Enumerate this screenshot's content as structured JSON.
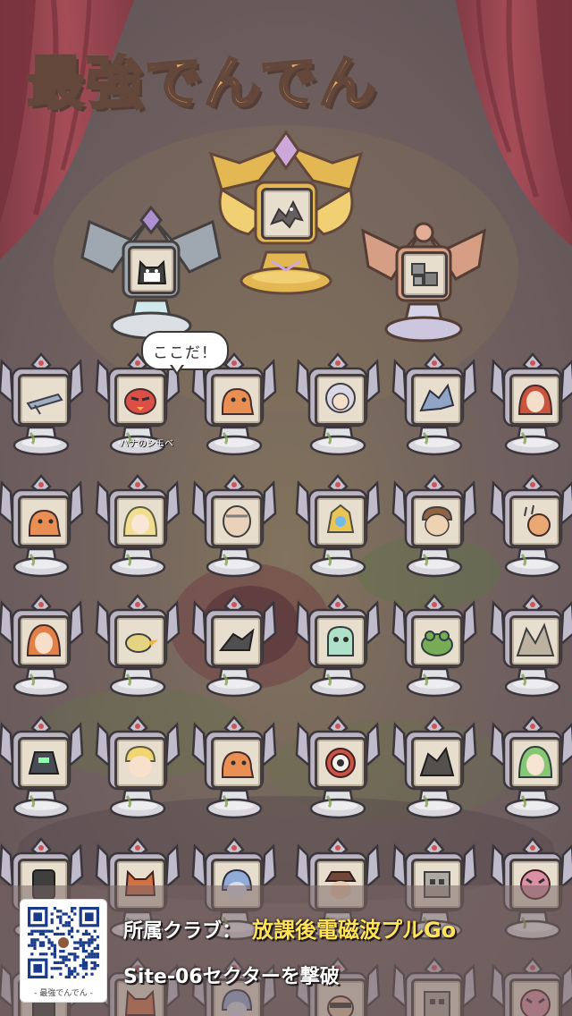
{
  "game": {
    "logo_text": "最強でんでん"
  },
  "bubble": {
    "text": "ここだ！"
  },
  "selected_character": {
    "label": "ハナのシモベ"
  },
  "banner": {
    "club_label": "所属クラブ：",
    "club_name": "放課後電磁波プルGo",
    "sector_text": "Site-06セクターを撃破",
    "qr_caption": "- 最強でんでん -"
  },
  "colors": {
    "curtain": "#9b3b47",
    "club_name": "#ffe15a",
    "gold_trophy": "#e2b348",
    "silver_trophy": "#9aa3ad",
    "bronze_trophy": "#d49a7e",
    "pedestal": "#c9c3cf"
  },
  "top_trophies": [
    {
      "rank": "gold",
      "icon": "dragon-portrait-icon"
    },
    {
      "rank": "silver",
      "icon": "cat-portrait-icon"
    },
    {
      "rank": "bronze",
      "icon": "robot-portrait-icon"
    }
  ],
  "grid": [
    [
      "airship-icon",
      "red-bird-icon",
      "orange-blob-icon",
      "curly-hair-girl-icon",
      "mecha-dragon-icon",
      "red-hair-girl-icon"
    ],
    [
      "orange-blob-icon",
      "blonde-girl-icon",
      "old-man-icon",
      "golden-armor-icon",
      "brown-hair-boy-icon",
      "snail-icon"
    ],
    [
      "orange-hair-girl-icon",
      "duck-icon",
      "dark-dragon-icon",
      "green-ghost-icon",
      "green-frog-icon",
      "cave-scene-icon"
    ],
    [
      "black-mecha-icon",
      "blonde-boy-icon",
      "orange-blob-icon",
      "eyeball-icon",
      "dark-beast-icon",
      "green-hair-girl-icon"
    ],
    [
      "shadow-figure-icon",
      "fox-icon",
      "blue-hair-icon",
      "hat-man-icon",
      "robot-box-icon",
      "angry-pink-icon"
    ],
    [
      "shadow-figure-icon",
      "fox-icon",
      "blue-hair-icon",
      "sunglasses-man-icon",
      "robot-box-icon",
      "angry-pink-icon"
    ]
  ]
}
